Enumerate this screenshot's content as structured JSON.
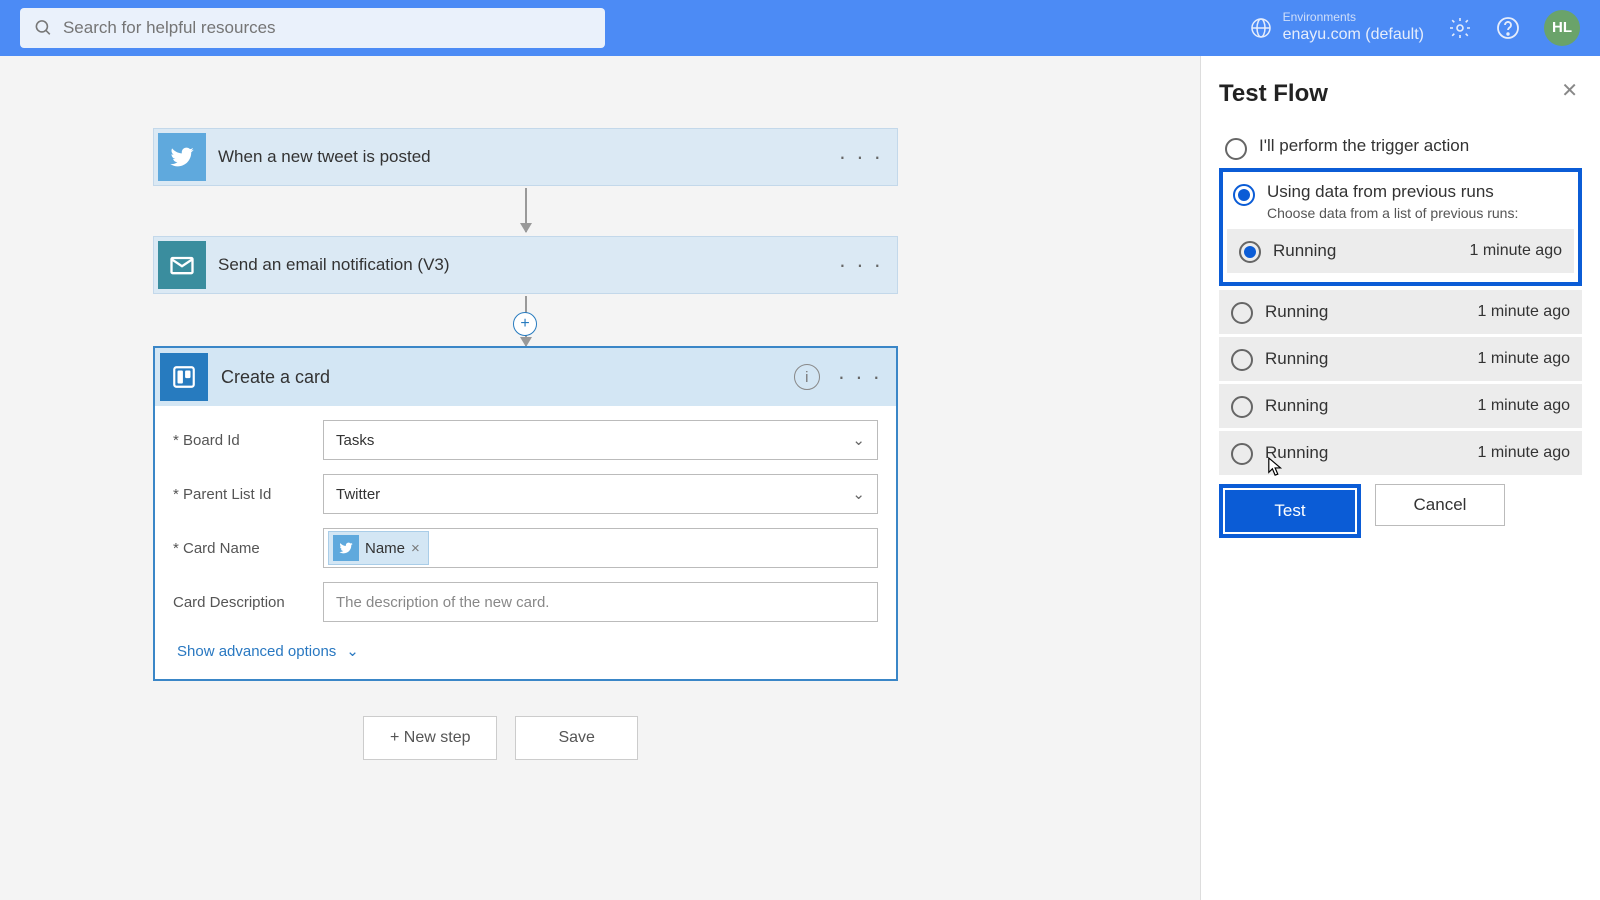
{
  "header": {
    "search_placeholder": "Search for helpful resources",
    "env_label": "Environments",
    "env_value": "enayu.com (default)",
    "avatar": "HL"
  },
  "flow": {
    "step1_title": "When a new tweet is posted",
    "step2_title": "Send an email notification (V3)",
    "step3_title": "Create a card",
    "form": {
      "board_label": "* Board Id",
      "board_value": "Tasks",
      "list_label": "* Parent List Id",
      "list_value": "Twitter",
      "name_label": "* Card Name",
      "name_token": "Name",
      "desc_label": "Card Description",
      "desc_placeholder": "The description of the new card.",
      "advanced": "Show advanced options"
    },
    "new_step": "+ New step",
    "save": "Save"
  },
  "panel": {
    "title": "Test Flow",
    "opt1": "I'll perform the trigger action",
    "opt2": "Using data from previous runs",
    "opt2_sub": "Choose data from a list of previous runs:",
    "runs": [
      {
        "status": "Running",
        "ago": "1 minute ago",
        "selected": true
      },
      {
        "status": "Running",
        "ago": "1 minute ago",
        "selected": false
      },
      {
        "status": "Running",
        "ago": "1 minute ago",
        "selected": false
      },
      {
        "status": "Running",
        "ago": "1 minute ago",
        "selected": false
      },
      {
        "status": "Running",
        "ago": "1 minute ago",
        "selected": false
      }
    ],
    "test": "Test",
    "cancel": "Cancel"
  }
}
